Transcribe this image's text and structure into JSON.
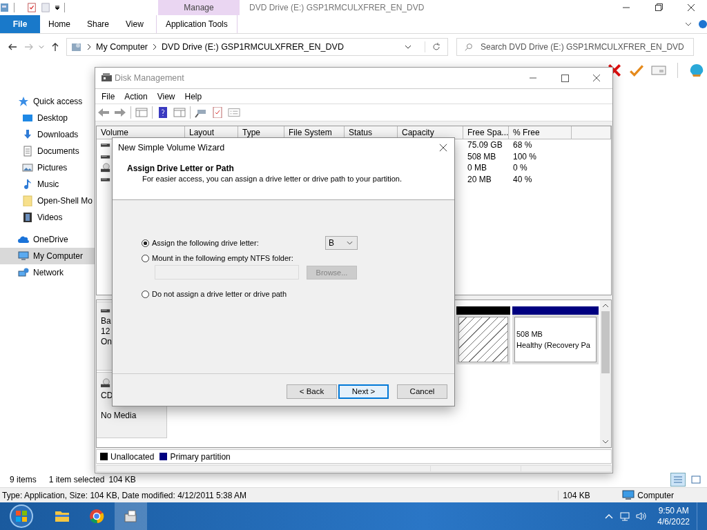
{
  "explorer": {
    "title": "DVD Drive (E:) GSP1RMCULXFRER_EN_DVD",
    "ribbon": {
      "context_label": "Manage",
      "tabs": [
        {
          "label": "File",
          "kind": "file"
        },
        {
          "label": "Home",
          "kind": "tab"
        },
        {
          "label": "Share",
          "kind": "tab"
        },
        {
          "label": "View",
          "kind": "tab"
        },
        {
          "label": "Application Tools",
          "kind": "context"
        }
      ]
    },
    "address": {
      "path": [
        "My Computer",
        "DVD Drive (E:) GSP1RMCULXFRER_EN_DVD"
      ]
    },
    "search": {
      "placeholder": "Search DVD Drive (E:) GSP1RMCULXFRER_EN_DVD"
    },
    "nav": [
      {
        "label": "Quick access",
        "kind": "star",
        "selected": false,
        "children": [
          {
            "label": "Desktop",
            "kind": "desktop",
            "selected": false
          },
          {
            "label": "Downloads",
            "kind": "download",
            "selected": false
          },
          {
            "label": "Documents",
            "kind": "document",
            "selected": false
          },
          {
            "label": "Pictures",
            "kind": "picture",
            "selected": false
          },
          {
            "label": "Music",
            "kind": "music",
            "selected": false
          },
          {
            "label": "Open-Shell Mo",
            "kind": "folder",
            "selected": false
          },
          {
            "label": "Videos",
            "kind": "video",
            "selected": false
          }
        ]
      },
      {
        "label": "OneDrive",
        "kind": "cloud",
        "selected": false
      },
      {
        "label": "My Computer",
        "kind": "computer",
        "selected": true
      },
      {
        "label": "Network",
        "kind": "network",
        "selected": false
      }
    ],
    "status": {
      "items": "9 items",
      "selection": "1 item selected",
      "size": "104 KB"
    },
    "details": {
      "text": "Type: Application, Size: 104 KB, Date modified: 4/12/2011 5:38 AM",
      "size": "104 KB",
      "location": "Computer"
    }
  },
  "disk_management": {
    "title": "Disk Management",
    "menu": [
      "File",
      "Action",
      "View",
      "Help"
    ],
    "columns": [
      "Volume",
      "Layout",
      "Type",
      "File System",
      "Status",
      "Capacity",
      "Free Spa...",
      "% Free"
    ],
    "rows": [
      {
        "kind": "disk",
        "free": "75.09 GB",
        "pct_free": "68 %"
      },
      {
        "kind": "disk",
        "free": "508 MB",
        "pct_free": "100 %"
      },
      {
        "kind": "cdrom",
        "free": "0 MB",
        "pct_free": "0 %"
      },
      {
        "kind": "disk",
        "free": "20 MB",
        "pct_free": "40 %"
      }
    ],
    "disks": [
      {
        "kind": "disk",
        "lines": [
          "Ba",
          "12",
          "On"
        ],
        "partitions": [
          {
            "kind": "unallocated"
          },
          {
            "kind": "primary",
            "lines": [
              "508 MB",
              "Healthy (Recovery Pa"
            ]
          }
        ]
      },
      {
        "kind": "cdrom",
        "lines": [
          "CD",
          "No Media"
        ]
      }
    ],
    "legend": [
      {
        "label": "Unallocated",
        "color": "#000000"
      },
      {
        "label": "Primary partition",
        "color": "#000080"
      }
    ]
  },
  "wizard": {
    "title": "New Simple Volume Wizard",
    "heading": "Assign Drive Letter or Path",
    "subheading": "For easier access, you can assign a drive letter or drive path to your partition.",
    "options": [
      {
        "label": "Assign the following drive letter:",
        "selected": true
      },
      {
        "label": "Mount in the following empty NTFS folder:",
        "selected": false
      },
      {
        "label": "Do not assign a drive letter or drive path",
        "selected": false
      }
    ],
    "drive_letter": "B",
    "folder_field": {
      "disabled": true
    },
    "browse": {
      "label": "Browse...",
      "disabled": true
    },
    "buttons": [
      {
        "label": "< Back",
        "default": false
      },
      {
        "label": "Next >",
        "default": true
      },
      {
        "label": "Cancel",
        "default": false
      }
    ]
  },
  "taskbar": {
    "apps": [
      {
        "kind": "folder",
        "active": false
      },
      {
        "kind": "browser",
        "active": false
      },
      {
        "kind": "installer",
        "active": true
      }
    ],
    "time": "9:50 AM",
    "date": "4/6/2022"
  }
}
